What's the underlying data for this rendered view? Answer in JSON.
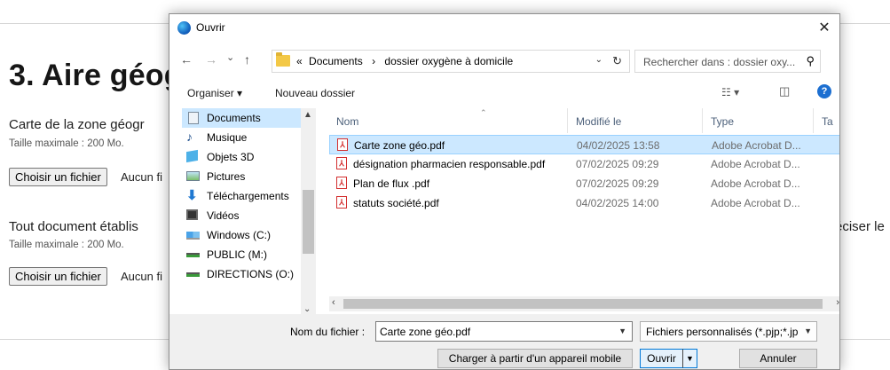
{
  "page": {
    "section_title": "3. Aire géog",
    "field1": {
      "label": "Carte de la zone géogr",
      "hint": "Taille maximale : 200 Mo.",
      "button": "Choisir un fichier",
      "no_file": "Aucun fi"
    },
    "field2": {
      "label": "Tout document établis",
      "label_right": "éciser le",
      "hint": "Taille maximale : 200 Mo.",
      "button": "Choisir un fichier",
      "no_file": "Aucun fi"
    }
  },
  "dialog": {
    "title": "Ouvrir",
    "close_glyph": "✕",
    "nav": {
      "back": "←",
      "forward": "→",
      "recent": "⌄",
      "up": "↑"
    },
    "address": {
      "prefix": "«",
      "crumbs": [
        "Documents",
        "dossier oxygène à domicile"
      ],
      "separator": "›",
      "dropdown": "⌄",
      "refresh": "↻"
    },
    "search": {
      "placeholder": "Rechercher dans : dossier oxy...",
      "icon": "search-icon"
    },
    "toolbar": {
      "organize": "Organiser ▾",
      "new_folder": "Nouveau dossier",
      "help": "?"
    },
    "sidebar": [
      {
        "label": "Documents",
        "icon": "documents-icon",
        "selected": true
      },
      {
        "label": "Musique",
        "icon": "music-icon"
      },
      {
        "label": "Objets 3D",
        "icon": "objects3d-icon"
      },
      {
        "label": "Pictures",
        "icon": "pictures-icon"
      },
      {
        "label": "Téléchargements",
        "icon": "downloads-icon"
      },
      {
        "label": "Vidéos",
        "icon": "videos-icon"
      },
      {
        "label": "Windows (C:)",
        "icon": "windows-drive-icon"
      },
      {
        "label": "PUBLIC (M:)",
        "icon": "network-drive-icon"
      },
      {
        "label": "DIRECTIONS (O:)",
        "icon": "network-drive-icon"
      }
    ],
    "columns": {
      "name": "Nom",
      "modified": "Modifié le",
      "type": "Type",
      "size": "Ta"
    },
    "files": [
      {
        "name": "Carte zone géo.pdf",
        "modified": "04/02/2025 13:58",
        "type": "Adobe Acrobat D...",
        "selected": true
      },
      {
        "name": "désignation pharmacien responsable.pdf",
        "modified": "07/02/2025 09:29",
        "type": "Adobe Acrobat D..."
      },
      {
        "name": "Plan de flux .pdf",
        "modified": "07/02/2025 09:29",
        "type": "Adobe Acrobat D..."
      },
      {
        "name": "statuts société.pdf",
        "modified": "04/02/2025 14:00",
        "type": "Adobe Acrobat D..."
      }
    ],
    "footer": {
      "filename_label": "Nom du fichier :",
      "filename_value": "Carte zone géo.pdf",
      "filter_value": "Fichiers personnalisés (*.pjp;*.jp",
      "mobile_button": "Charger à partir d'un appareil mobile",
      "open_button": "Ouvrir",
      "cancel_button": "Annuler"
    }
  }
}
